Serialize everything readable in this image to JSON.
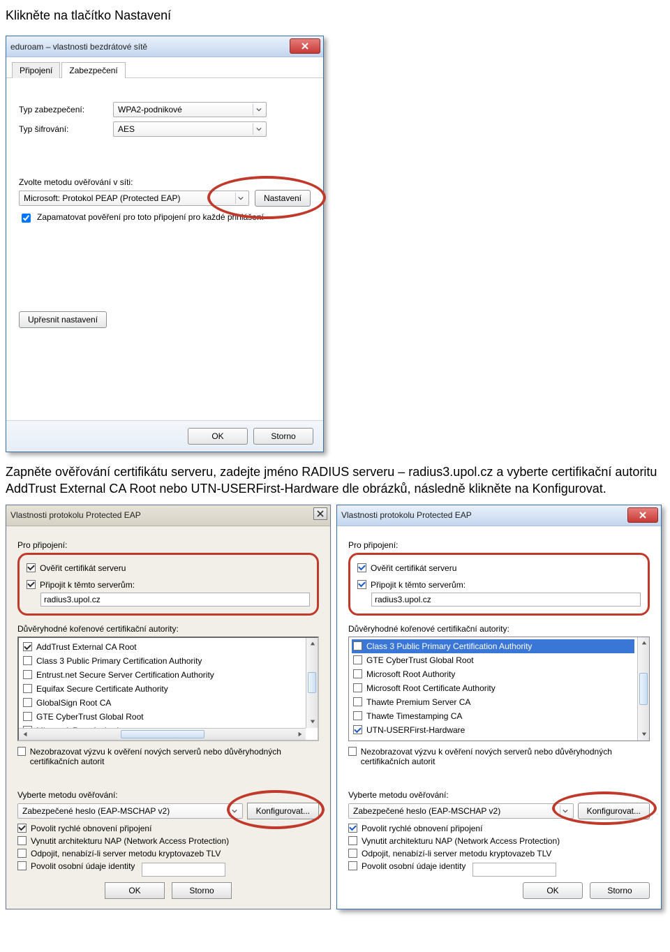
{
  "doc": {
    "heading1": "Klikněte na tlačítko Nastavení",
    "para1": "Zapněte ověřování certifikátu serveru, zadejte jméno RADIUS serveru – radius3.upol.cz a vyberte certifikační autoritu AddTrust External CA Root nebo UTN-USERFirst-Hardware dle obrázků, následně klikněte na Konfigurovat."
  },
  "win1": {
    "title": "eduroam – vlastnosti bezdrátové sítě",
    "tabs": {
      "connection": "Připojení",
      "security": "Zabezpečení"
    },
    "security_type_label": "Typ zabezpečení:",
    "security_type_value": "WPA2-podnikové",
    "encryption_label": "Typ šifrování:",
    "encryption_value": "AES",
    "auth_method_label": "Zvolte metodu ověřování v síti:",
    "auth_method_value": "Microsoft: Protokol PEAP (Protected EAP)",
    "settings_btn": "Nastavení",
    "remember_chk": "Zapamatovat pověření pro toto připojení pro každé přihlášení",
    "advanced_btn": "Upřesnit nastavení",
    "ok": "OK",
    "cancel": "Storno"
  },
  "eap_common": {
    "title": "Vlastnosti protokolu Protected EAP",
    "for_connection": "Pro připojení:",
    "verify_cert": "Ověřit certifikát serveru",
    "connect_servers": "Připojit k těmto serverům:",
    "server_value": "radius3.upol.cz",
    "trusted_cas": "Důvěryhodné kořenové certifikační autority:",
    "no_prompt_classic": "Nezobrazovat výzvu k ověření nových serverů nebo důvěryhodných certifikačních autorit",
    "no_prompt_modern": "Nezobrazovat výzvu k ověření nových serverů nebo důvěryhodných certifikačních autorit",
    "select_auth": "Vyberte metodu ověřování:",
    "mschap": "Zabezpečené heslo (EAP-MSCHAP v2)",
    "configure": "Konfigurovat...",
    "fast_reconnect": "Povolit rychlé obnovení připojení",
    "nap": "Vynutit architekturu NAP (Network Access Protection)",
    "tlv": "Odpojit, nenabízí-li server metodu kryptovazeb TLV",
    "identity": "Povolit osobní údaje identity",
    "ok": "OK",
    "cancel": "Storno"
  },
  "cas_left": [
    "AddTrust External CA Root",
    "Class 3 Public Primary Certification Authority",
    "Entrust.net Secure Server Certification Authority",
    "Equifax Secure Certificate Authority",
    "GlobalSign Root CA",
    "GTE CyberTrust Global Root",
    "Microsoft Root Authority"
  ],
  "cas_right": [
    "Class 3 Public Primary Certification Authority",
    "GTE CyberTrust Global Root",
    "Microsoft Root Authority",
    "Microsoft Root Certificate Authority",
    "Thawte Premium Server CA",
    "Thawte Timestamping CA",
    "UTN-USERFirst-Hardware"
  ]
}
